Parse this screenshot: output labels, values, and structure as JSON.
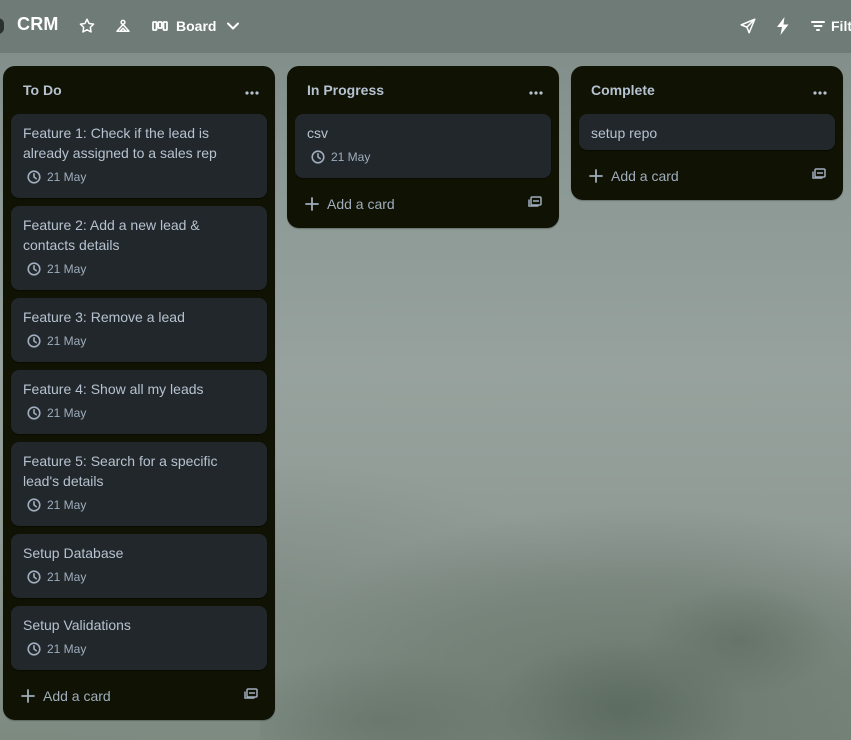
{
  "header": {
    "board_title": "CRM",
    "view_label": "Board",
    "filter_label": "Filters",
    "icons": [
      "star-icon",
      "workspace-visibility-icon",
      "board-view-icon",
      "chevron-down-icon",
      "send-icon",
      "automation-icon",
      "filter-icon"
    ]
  },
  "lists": [
    {
      "title": "To Do",
      "cards": [
        {
          "title": "Feature 1: Check if the lead is already assigned to a sales rep",
          "date": "21 May"
        },
        {
          "title": "Feature 2: Add a new lead & contacts details",
          "date": "21 May"
        },
        {
          "title": "Feature 3: Remove a lead",
          "date": "21 May"
        },
        {
          "title": "Feature 4: Show all my leads",
          "date": "21 May"
        },
        {
          "title": "Feature 5: Search for a specific lead's details",
          "date": "21 May"
        },
        {
          "title": "Setup Database",
          "date": "21 May"
        },
        {
          "title": "Setup Validations",
          "date": "21 May"
        }
      ],
      "add_card_label": "Add a card"
    },
    {
      "title": "In Progress",
      "cards": [
        {
          "title": "csv",
          "date": "21 May"
        }
      ],
      "add_card_label": "Add a card"
    },
    {
      "title": "Complete",
      "cards": [
        {
          "title": "setup repo"
        }
      ],
      "add_card_label": "Add a card"
    }
  ],
  "colors": {
    "list_bg": "#101204",
    "card_bg": "#22272b",
    "text_primary": "#b6c2cf",
    "text_secondary": "#9fadbc",
    "header_text": "#ffffff"
  }
}
